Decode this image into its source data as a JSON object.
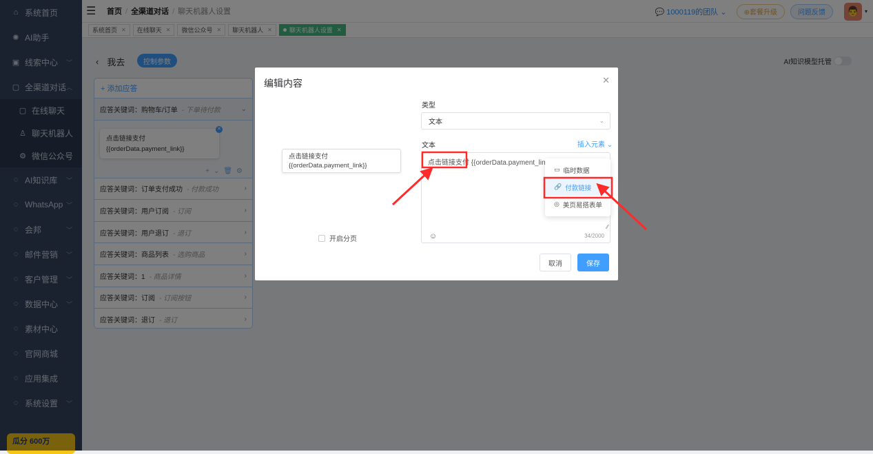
{
  "sidebar": {
    "items": [
      {
        "label": "系统首页",
        "icon": "home-icon"
      },
      {
        "label": "AI助手",
        "icon": "ai-icon"
      },
      {
        "label": "线索中心",
        "icon": "leads-icon",
        "chevron": "down"
      },
      {
        "label": "全渠道对话",
        "icon": "chat-icon",
        "chevron": "up"
      }
    ],
    "subitems": [
      {
        "label": "在线聊天",
        "icon": "chat-icon"
      },
      {
        "label": "聊天机器人",
        "icon": "robot-icon"
      },
      {
        "label": "微信公众号",
        "icon": "gear-icon"
      }
    ],
    "items2": [
      {
        "label": "AI知识库",
        "chevron": "down"
      },
      {
        "label": "WhatsApp",
        "chevron": "down"
      },
      {
        "label": "会邦",
        "chevron": "down"
      },
      {
        "label": "邮件营销",
        "chevron": "down"
      },
      {
        "label": "客户管理",
        "chevron": "down"
      },
      {
        "label": "数据中心",
        "chevron": "down"
      },
      {
        "label": "素材中心"
      },
      {
        "label": "官网商城"
      },
      {
        "label": "应用集成"
      },
      {
        "label": "系统设置",
        "chevron": "down"
      }
    ],
    "promo": "瓜分 600万"
  },
  "header": {
    "breadcrumb": [
      "首页",
      "全渠道对话",
      "聊天机器人设置"
    ],
    "team": "1000119的团队",
    "upgrade": "⊕套餐升级",
    "feedback": "问题反馈"
  },
  "tabs": [
    {
      "label": "系统首页"
    },
    {
      "label": "在线聊天"
    },
    {
      "label": "微信公众号"
    },
    {
      "label": "聊天机器人"
    },
    {
      "label": "聊天机器人设置",
      "active": true
    }
  ],
  "page": {
    "back": "我去",
    "control": "控制参数",
    "ai_toggle": "AI知识模型托管",
    "ai_toggle_on": false,
    "add": "+ 添加应答",
    "keywords": [
      {
        "label": "应答关键词：购物车/订单",
        "note": "- 下单待付款",
        "open": true
      },
      {
        "label": "应答关键词：订单支付成功",
        "note": "- 付款成功"
      },
      {
        "label": "应答关键词：用户订阅",
        "note": "- 订阅"
      },
      {
        "label": "应答关键词：用户退订",
        "note": "- 退订"
      },
      {
        "label": "应答关键词：商品列表",
        "note": "- 选购商品"
      },
      {
        "label": "应答关键词：1",
        "note": "- 商品详情"
      },
      {
        "label": "应答关键词：订阅",
        "note": "- 订阅按钮"
      },
      {
        "label": "应答关键词：退订",
        "note": "- 退订"
      }
    ],
    "bubble_line1": "点击链接支付",
    "bubble_line2": "{{orderData.payment_link}}"
  },
  "modal": {
    "title": "编辑内容",
    "preview_line1": "点击链接支付",
    "preview_line2": "{{orderData.payment_link}}",
    "paging": "开启分页",
    "type_label": "类型",
    "type_value": "文本",
    "text_label": "文本",
    "insert": "插入元素",
    "text_highlight": "点击链接支付",
    "text_rest": " {{orderData.payment_link}}",
    "count": "34/2000",
    "menu": [
      {
        "label": "临时数据",
        "icon": "comment-icon"
      },
      {
        "label": "付款链接",
        "icon": "link-icon",
        "highlight": true
      },
      {
        "label": "美页易搭表单",
        "icon": "form-icon"
      }
    ],
    "cancel": "取消",
    "save": "保存"
  },
  "colors": {
    "accent": "#409eff",
    "active_tab": "#42b983",
    "annotation": "#ff2a2a"
  }
}
